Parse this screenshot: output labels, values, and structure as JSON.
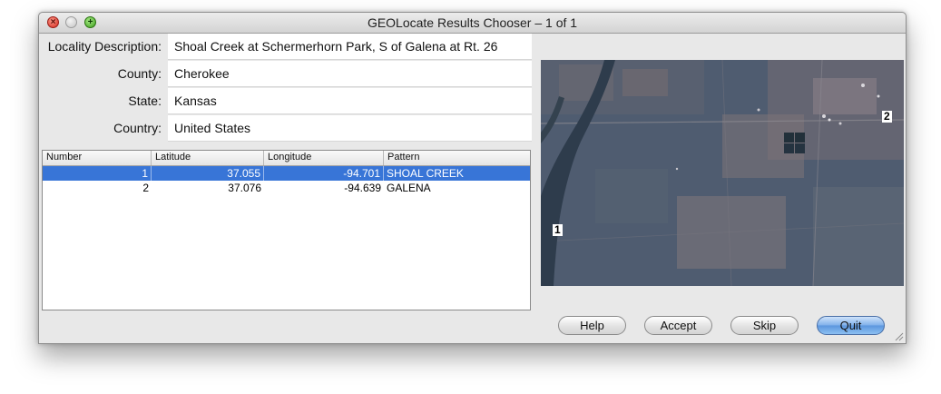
{
  "window": {
    "title": "GEOLocate Results Chooser – 1 of 1"
  },
  "form": {
    "locality_label": "Locality Description:",
    "locality_value": "Shoal Creek at Schermerhorn Park, S of Galena at Rt. 26",
    "county_label": "County:",
    "county_value": "Cherokee",
    "state_label": "State:",
    "state_value": "Kansas",
    "country_label": "Country:",
    "country_value": "United States"
  },
  "table": {
    "columns": [
      "Number",
      "Latitude",
      "Longitude",
      "Pattern"
    ],
    "rows": [
      {
        "number": "1",
        "latitude": "37.055",
        "longitude": "-94.701",
        "pattern": "SHOAL CREEK",
        "selected": true
      },
      {
        "number": "2",
        "latitude": "37.076",
        "longitude": "-94.639",
        "pattern": "GALENA",
        "selected": false
      }
    ]
  },
  "map": {
    "markers": [
      "1",
      "2"
    ]
  },
  "buttons": {
    "help": "Help",
    "accept": "Accept",
    "skip": "Skip",
    "quit": "Quit"
  },
  "colors": {
    "selection": "#3875d7",
    "default_button": "#5b95de"
  }
}
